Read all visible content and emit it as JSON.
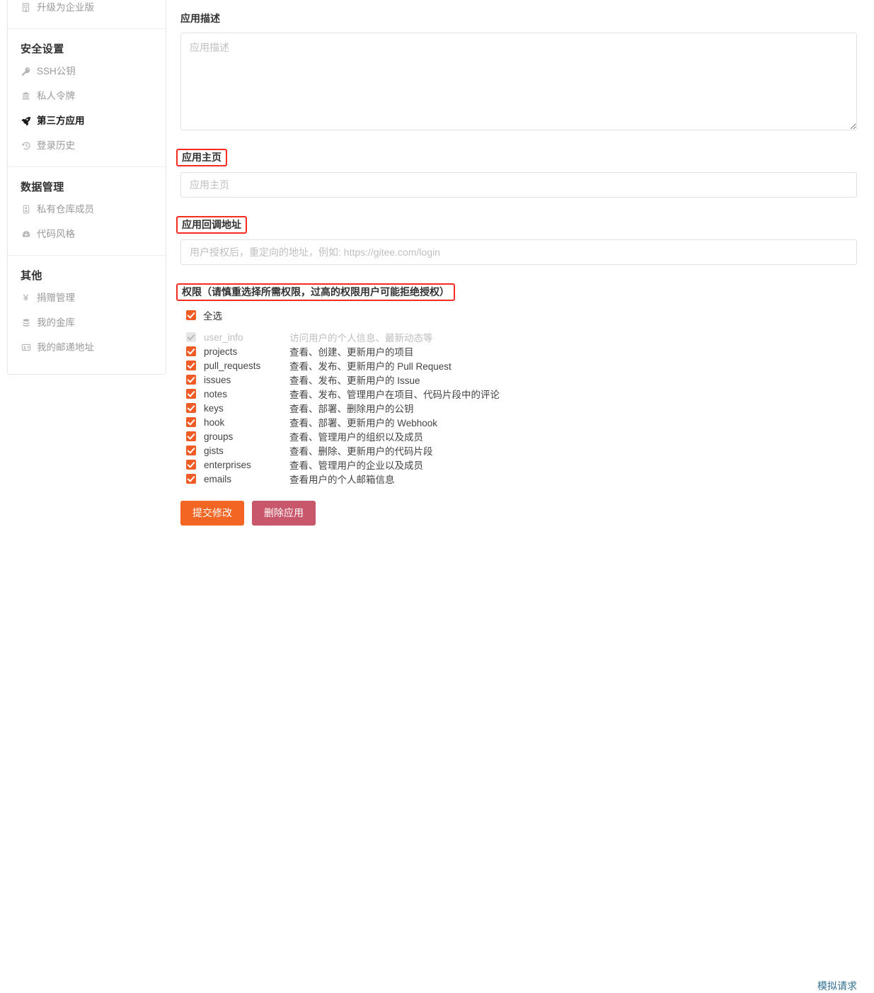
{
  "sidebar": {
    "top_item": {
      "label": "升级为企业版",
      "icon": "building-icon"
    },
    "groups": [
      {
        "title": "安全设置",
        "items": [
          {
            "label": "SSH公钥",
            "icon": "key-icon",
            "active": false
          },
          {
            "label": "私人令牌",
            "icon": "token-icon",
            "active": false
          },
          {
            "label": "第三方应用",
            "icon": "rocket-icon",
            "active": true
          },
          {
            "label": "登录历史",
            "icon": "history-icon",
            "active": false
          }
        ]
      },
      {
        "title": "数据管理",
        "items": [
          {
            "label": "私有仓库成员",
            "icon": "id-card-icon",
            "active": false
          },
          {
            "label": "代码风格",
            "icon": "speedometer-icon",
            "active": false
          }
        ]
      },
      {
        "title": "其他",
        "items": [
          {
            "label": "捐赠管理",
            "icon": "yen-icon",
            "active": false
          },
          {
            "label": "我的金库",
            "icon": "coins-icon",
            "active": false
          },
          {
            "label": "我的邮递地址",
            "icon": "address-card-icon",
            "active": false
          }
        ]
      }
    ]
  },
  "form": {
    "description": {
      "label": "应用描述",
      "placeholder": "应用描述",
      "value": "",
      "highlighted": false
    },
    "homepage": {
      "label": "应用主页",
      "placeholder": "应用主页",
      "value": "",
      "highlighted": true
    },
    "callback": {
      "label": "应用回调地址",
      "placeholder": "用户授权后，重定向的地址，例如: https://gitee.com/login",
      "value": "",
      "highlighted": true
    },
    "permissions": {
      "label": "权限（请慎重选择所需权限，过高的权限用户可能拒绝授权）",
      "highlighted": true,
      "select_all": {
        "label": "全选",
        "checked": true
      },
      "items": [
        {
          "name": "user_info",
          "desc": "访问用户的个人信息、最新动态等",
          "checked": true,
          "disabled": true
        },
        {
          "name": "projects",
          "desc": "查看、创建、更新用户的项目",
          "checked": true,
          "disabled": false
        },
        {
          "name": "pull_requests",
          "desc": "查看、发布、更新用户的 Pull Request",
          "checked": true,
          "disabled": false
        },
        {
          "name": "issues",
          "desc": "查看、发布、更新用户的 Issue",
          "checked": true,
          "disabled": false
        },
        {
          "name": "notes",
          "desc": "查看、发布、管理用户在项目、代码片段中的评论",
          "checked": true,
          "disabled": false
        },
        {
          "name": "keys",
          "desc": "查看、部署、删除用户的公钥",
          "checked": true,
          "disabled": false
        },
        {
          "name": "hook",
          "desc": "查看、部署、更新用户的 Webhook",
          "checked": true,
          "disabled": false
        },
        {
          "name": "groups",
          "desc": "查看、管理用户的组织以及成员",
          "checked": true,
          "disabled": false
        },
        {
          "name": "gists",
          "desc": "查看、删除、更新用户的代码片段",
          "checked": true,
          "disabled": false
        },
        {
          "name": "enterprises",
          "desc": "查看、管理用户的企业以及成员",
          "checked": true,
          "disabled": false
        },
        {
          "name": "emails",
          "desc": "查看用户的个人邮箱信息",
          "checked": true,
          "disabled": false
        }
      ]
    },
    "actions": {
      "submit_label": "提交修改",
      "delete_label": "删除应用",
      "simulate_label": "模拟请求"
    }
  },
  "colors": {
    "accent": "#f26522",
    "checkbox": "#ef5b25",
    "danger": "#c9576b",
    "highlight_border": "#f52c1f",
    "link": "#2f6f93"
  }
}
